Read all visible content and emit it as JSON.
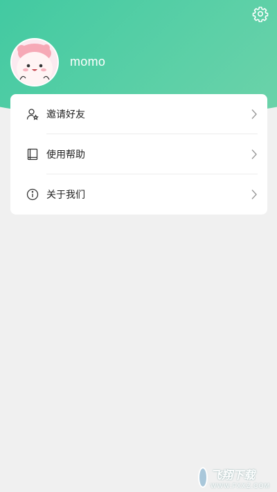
{
  "header": {
    "settings_icon": "gear-icon",
    "username": "momo",
    "avatar_icon": "cartoon-avatar",
    "accent_color": "#3cc8a0"
  },
  "menu": {
    "items": [
      {
        "label": "邀请好友",
        "icon": "user-star-icon"
      },
      {
        "label": "使用帮助",
        "icon": "book-icon"
      },
      {
        "label": "关于我们",
        "icon": "info-icon"
      }
    ],
    "chevron_icon": "chevron-right-icon"
  },
  "watermark": {
    "title": "飞翔下载",
    "subtitle": "WWW.FXXZ.COM"
  }
}
